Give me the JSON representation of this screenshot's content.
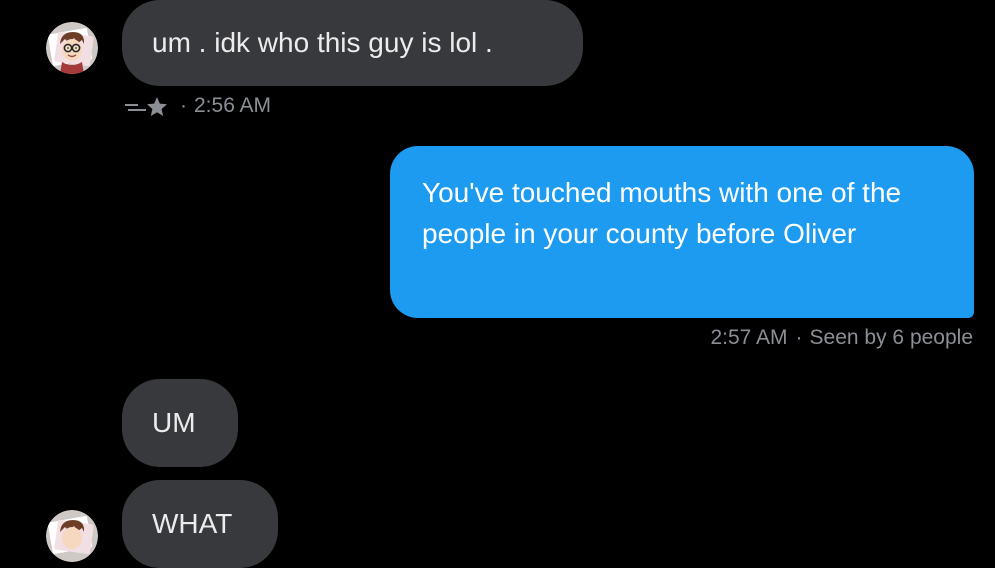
{
  "conversation": {
    "messages": [
      {
        "direction": "incoming",
        "text": "um . idk who this guy is lol ."
      },
      {
        "direction": "outgoing",
        "text": "You've touched mouths with one of the people in your county before Oliver"
      },
      {
        "direction": "incoming",
        "text": "UM"
      },
      {
        "direction": "incoming",
        "text": "WHAT"
      }
    ],
    "meta_first": {
      "icon": "reaction-star-icon",
      "separator": "·",
      "time": "2:56 AM"
    },
    "meta_outgoing": {
      "time": "2:57 AM",
      "separator": "·",
      "seen": "Seen by 6 people"
    }
  },
  "colors": {
    "background": "#000000",
    "incoming_bubble": "#38393d",
    "outgoing_bubble": "#1d9bf0",
    "meta_text": "#8b8f95"
  }
}
